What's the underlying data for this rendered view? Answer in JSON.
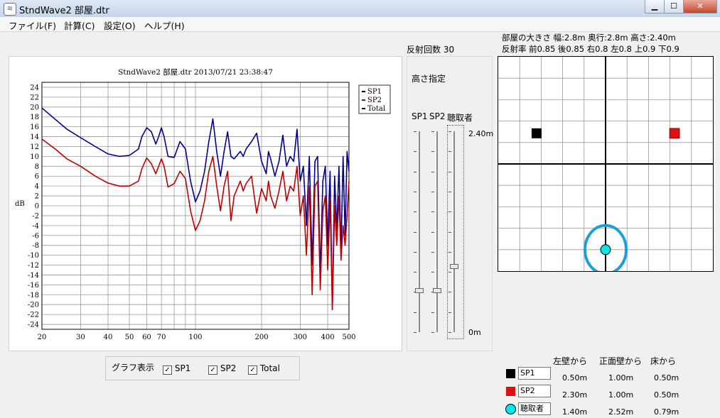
{
  "window": {
    "title": "StndWave2 部屋.dtr",
    "icon": "app-icon",
    "buttons": [
      "minimize-icon",
      "maximize-icon",
      "close-icon"
    ]
  },
  "menu": [
    "ファイル(F)",
    "計算(C)",
    "設定(O)",
    "ヘルプ(H)"
  ],
  "info": {
    "room_size": "部屋の大きさ 幅:2.8m 奥行:2.8m 高さ:2.40m",
    "reflectance": "反射率  前0.85  後0.85  右0.8  左0.8  上0.9  下0.9",
    "reflection_count": "反射回数 30",
    "height_spec": "高さ指定"
  },
  "sliders": {
    "labels": [
      "SP1",
      "SP2",
      "聴取者"
    ],
    "values_m": [
      0.5,
      0.5,
      0.79
    ],
    "max_label": "2.40m",
    "min_label": "0m"
  },
  "graph_display": {
    "label": "グラフ表示",
    "items": [
      {
        "label": "SP1",
        "checked": true
      },
      {
        "label": "SP2",
        "checked": true
      },
      {
        "label": "Total",
        "checked": true
      }
    ]
  },
  "positions_table": {
    "headers": [
      "左壁から",
      "正面壁から",
      "床から"
    ],
    "rows": [
      {
        "name": "SP1",
        "color": "#000000",
        "shape": "square",
        "left": "0.50m",
        "front": "1.00m",
        "floor": "0.50m"
      },
      {
        "name": "SP2",
        "color": "#e01010",
        "shape": "square",
        "left": "2.30m",
        "front": "1.00m",
        "floor": "0.50m"
      },
      {
        "name": "聴取者",
        "color": "#00e8e8",
        "shape": "circle",
        "left": "1.40m",
        "front": "2.52m",
        "floor": "0.79m"
      }
    ]
  },
  "room_map": {
    "width_m": 2.8,
    "depth_m": 2.8,
    "sp1": {
      "x_m": 0.5,
      "y_m": 1.0,
      "color": "#000000"
    },
    "sp2": {
      "x_m": 2.3,
      "y_m": 1.0,
      "color": "#e01010"
    },
    "listener": {
      "x_m": 1.4,
      "y_m": 2.52,
      "color": "#00e8e8",
      "ring_color": "#1aa0d8"
    }
  },
  "chart_data": {
    "type": "line",
    "title": "StndWave2 部屋.dtr    2013/07/21 23:38:47",
    "xlabel": "",
    "ylabel": "dB",
    "xscale": "log",
    "xlim": [
      20,
      500
    ],
    "ylim": [
      -25,
      25
    ],
    "x_ticks": [
      20,
      30,
      40,
      50,
      60,
      70,
      100,
      200,
      300,
      400,
      500
    ],
    "y_ticks": [
      24,
      22,
      20,
      18,
      16,
      14,
      12,
      10,
      8,
      6,
      4,
      2,
      0,
      -2,
      -4,
      -6,
      -8,
      -10,
      -12,
      -14,
      -16,
      -18,
      -20,
      -22,
      -24
    ],
    "grid": true,
    "legend": [
      "SP1",
      "SP2",
      "Total"
    ],
    "legend_colors": [
      "#000000",
      "#c00000",
      "#000090"
    ],
    "series": [
      {
        "name": "Total",
        "color": "#000090",
        "x": [
          20,
          23,
          26,
          30,
          35,
          40,
          45,
          50,
          55,
          57,
          60,
          63,
          66,
          68,
          70,
          72,
          75,
          80,
          85,
          90,
          95,
          100,
          105,
          110,
          115,
          120,
          125,
          130,
          135,
          140,
          145,
          150,
          160,
          165,
          170,
          180,
          190,
          200,
          210,
          215,
          220,
          230,
          240,
          250,
          260,
          270,
          280,
          290,
          300,
          310,
          320,
          330,
          340,
          350,
          360,
          370,
          380,
          390,
          400,
          410,
          420,
          430,
          440,
          450,
          460,
          470,
          480,
          490,
          500
        ],
        "y": [
          19.8,
          17.5,
          15.5,
          13.8,
          12,
          10.5,
          10,
          10.2,
          11.5,
          14,
          15.8,
          15,
          12.5,
          14,
          15.8,
          14,
          10,
          9.8,
          13,
          11.5,
          5,
          0.8,
          3,
          7,
          13,
          17.6,
          11,
          6,
          11,
          15,
          10,
          9.5,
          11,
          10,
          11.5,
          13,
          14.7,
          9,
          6.5,
          11,
          9.5,
          6,
          9,
          14.3,
          8,
          10,
          9,
          15.5,
          5,
          8,
          -4,
          10,
          -12,
          9,
          10,
          -14,
          5,
          8,
          -8,
          7,
          -21,
          6,
          -5,
          8,
          -9,
          10,
          -6,
          11,
          7
        ]
      },
      {
        "name": "SP2",
        "color": "#c00000",
        "x": [
          20,
          23,
          26,
          30,
          35,
          40,
          45,
          50,
          55,
          57,
          60,
          63,
          66,
          68,
          70,
          72,
          75,
          80,
          85,
          90,
          95,
          100,
          105,
          110,
          115,
          120,
          125,
          130,
          135,
          140,
          145,
          150,
          160,
          165,
          170,
          180,
          190,
          200,
          210,
          215,
          220,
          230,
          240,
          250,
          260,
          270,
          280,
          290,
          300,
          310,
          320,
          330,
          340,
          350,
          360,
          370,
          380,
          390,
          400,
          410,
          420,
          430,
          440,
          450,
          460,
          470,
          480,
          490,
          500
        ],
        "y": [
          13.5,
          11.5,
          9.5,
          8,
          6,
          4.6,
          4,
          4,
          5,
          7.5,
          9.7,
          8.5,
          6.5,
          8,
          9.5,
          8,
          3.8,
          4.5,
          7,
          5.5,
          -1,
          -5,
          -3,
          1,
          7,
          10,
          4,
          -1,
          4,
          7,
          -3,
          2,
          5,
          3,
          4.5,
          6,
          -1.5,
          3.5,
          1,
          5,
          2,
          -0.5,
          3,
          7,
          1,
          4,
          3,
          8,
          -2,
          2,
          -10,
          4,
          -18,
          4,
          5,
          -17,
          -1,
          2,
          -13,
          1,
          -21,
          0,
          -8,
          2,
          -11,
          -4,
          -8,
          -2,
          5
        ]
      }
    ]
  }
}
